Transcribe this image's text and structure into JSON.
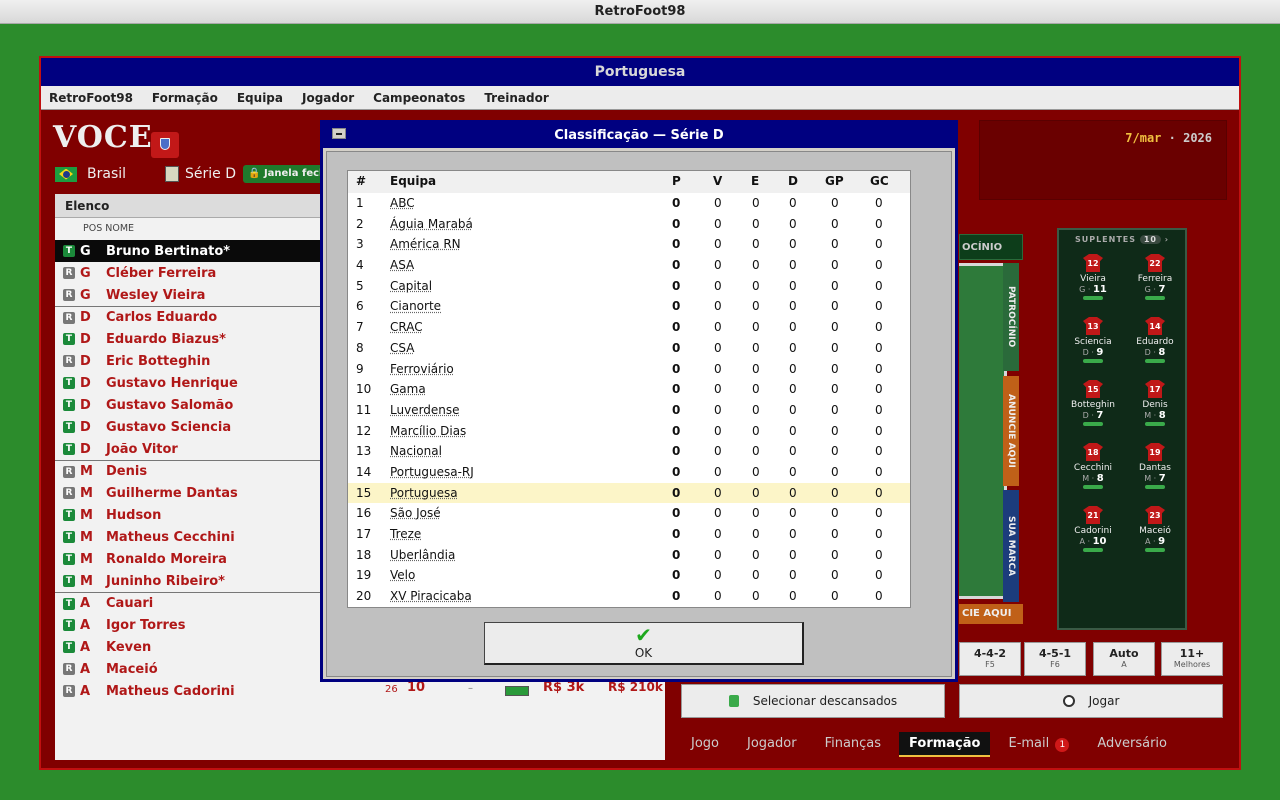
{
  "app_title": "RetroFoot98",
  "window_title": "Portuguesa",
  "menu": [
    "RetroFoot98",
    "Formação",
    "Equipa",
    "Jogador",
    "Campeonatos",
    "Treinador"
  ],
  "header": {
    "coach": "VOCE",
    "country": "Brasil",
    "division": "Série D",
    "window_status": "Janela fechada",
    "date": "7/mar",
    "year": "2026"
  },
  "roster": {
    "title": "Elenco",
    "col_pos": "POS",
    "col_name": "NOME",
    "players": [
      {
        "badge": "T",
        "pos": "G",
        "name": "Bruno Bertinato*"
      },
      {
        "badge": "R",
        "pos": "G",
        "name": "Cléber Ferreira"
      },
      {
        "badge": "R",
        "pos": "G",
        "name": "Wesley Vieira"
      },
      {
        "badge": "R",
        "pos": "D",
        "name": "Carlos Eduardo"
      },
      {
        "badge": "T",
        "pos": "D",
        "name": "Eduardo Biazus*"
      },
      {
        "badge": "R",
        "pos": "D",
        "name": "Eric Botteghin"
      },
      {
        "badge": "T",
        "pos": "D",
        "name": "Gustavo Henrique"
      },
      {
        "badge": "T",
        "pos": "D",
        "name": "Gustavo Salomão"
      },
      {
        "badge": "T",
        "pos": "D",
        "name": "Gustavo Sciencia"
      },
      {
        "badge": "T",
        "pos": "D",
        "name": "João Vitor"
      },
      {
        "badge": "R",
        "pos": "M",
        "name": "Denis"
      },
      {
        "badge": "R",
        "pos": "M",
        "name": "Guilherme Dantas"
      },
      {
        "badge": "T",
        "pos": "M",
        "name": "Hudson"
      },
      {
        "badge": "T",
        "pos": "M",
        "name": "Matheus Cecchini"
      },
      {
        "badge": "T",
        "pos": "M",
        "name": "Ronaldo Moreira"
      },
      {
        "badge": "T",
        "pos": "M",
        "name": "Juninho Ribeiro*"
      },
      {
        "badge": "T",
        "pos": "A",
        "name": "Cauari"
      },
      {
        "badge": "T",
        "pos": "A",
        "name": "Igor Torres"
      },
      {
        "badge": "T",
        "pos": "A",
        "name": "Keven"
      },
      {
        "badge": "R",
        "pos": "A",
        "name": "Maceió"
      },
      {
        "badge": "R",
        "pos": "A",
        "name": "Matheus Cadorini"
      }
    ],
    "last_row_extra": {
      "age": "26",
      "rating": "10",
      "dash": "–",
      "wage": "R$ 3k",
      "value": "R$ 210k"
    }
  },
  "pitch": {
    "tab_partial": "OCÍNIO",
    "ads": [
      "PATROCÍNIO",
      "ANUNCIE AQUI",
      "SUA MARCA"
    ],
    "bottom_ad": "CIE AQUI"
  },
  "bench": {
    "title": "SUPLENTES",
    "count": "10",
    "players": [
      {
        "num": "12",
        "name": "Vieira",
        "pos": "G",
        "rating": "11"
      },
      {
        "num": "22",
        "name": "Ferreira",
        "pos": "G",
        "rating": "7"
      },
      {
        "num": "13",
        "name": "Sciencia",
        "pos": "D",
        "rating": "9"
      },
      {
        "num": "14",
        "name": "Eduardo",
        "pos": "D",
        "rating": "8"
      },
      {
        "num": "15",
        "name": "Botteghin",
        "pos": "D",
        "rating": "7"
      },
      {
        "num": "17",
        "name": "Denis",
        "pos": "M",
        "rating": "8"
      },
      {
        "num": "18",
        "name": "Cecchini",
        "pos": "M",
        "rating": "8"
      },
      {
        "num": "19",
        "name": "Dantas",
        "pos": "M",
        "rating": "7"
      },
      {
        "num": "21",
        "name": "Cadorini",
        "pos": "A",
        "rating": "10"
      },
      {
        "num": "23",
        "name": "Maceió",
        "pos": "A",
        "rating": "9"
      }
    ]
  },
  "formations": [
    {
      "label": "4-4-2",
      "key": "F5"
    },
    {
      "label": "4-5-1",
      "key": "F6"
    },
    {
      "label": "Auto",
      "key": "A"
    },
    {
      "label": "11+",
      "key": "Melhores"
    }
  ],
  "buttons": {
    "rested": "Selecionar descansados",
    "play": "Jogar"
  },
  "bottom_tabs": [
    "Jogo",
    "Jogador",
    "Finanças",
    "Formação",
    "E-mail",
    "Adversário"
  ],
  "email_count": "1",
  "dialog": {
    "title": "Classificação — Série D",
    "columns": [
      "#",
      "Equipa",
      "P",
      "V",
      "E",
      "D",
      "GP",
      "GC"
    ],
    "rows": [
      [
        "1",
        "ABC",
        "0",
        "0",
        "0",
        "0",
        "0",
        "0"
      ],
      [
        "2",
        "Águia Marabá",
        "0",
        "0",
        "0",
        "0",
        "0",
        "0"
      ],
      [
        "3",
        "América RN",
        "0",
        "0",
        "0",
        "0",
        "0",
        "0"
      ],
      [
        "4",
        "ASA",
        "0",
        "0",
        "0",
        "0",
        "0",
        "0"
      ],
      [
        "5",
        "Capital",
        "0",
        "0",
        "0",
        "0",
        "0",
        "0"
      ],
      [
        "6",
        "Cianorte",
        "0",
        "0",
        "0",
        "0",
        "0",
        "0"
      ],
      [
        "7",
        "CRAC",
        "0",
        "0",
        "0",
        "0",
        "0",
        "0"
      ],
      [
        "8",
        "CSA",
        "0",
        "0",
        "0",
        "0",
        "0",
        "0"
      ],
      [
        "9",
        "Ferroviário",
        "0",
        "0",
        "0",
        "0",
        "0",
        "0"
      ],
      [
        "10",
        "Gama",
        "0",
        "0",
        "0",
        "0",
        "0",
        "0"
      ],
      [
        "11",
        "Luverdense",
        "0",
        "0",
        "0",
        "0",
        "0",
        "0"
      ],
      [
        "12",
        "Marcílio Dias",
        "0",
        "0",
        "0",
        "0",
        "0",
        "0"
      ],
      [
        "13",
        "Nacional",
        "0",
        "0",
        "0",
        "0",
        "0",
        "0"
      ],
      [
        "14",
        "Portuguesa-RJ",
        "0",
        "0",
        "0",
        "0",
        "0",
        "0"
      ],
      [
        "15",
        "Portuguesa",
        "0",
        "0",
        "0",
        "0",
        "0",
        "0"
      ],
      [
        "16",
        "São José",
        "0",
        "0",
        "0",
        "0",
        "0",
        "0"
      ],
      [
        "17",
        "Treze",
        "0",
        "0",
        "0",
        "0",
        "0",
        "0"
      ],
      [
        "18",
        "Uberlândia",
        "0",
        "0",
        "0",
        "0",
        "0",
        "0"
      ],
      [
        "19",
        "Velo",
        "0",
        "0",
        "0",
        "0",
        "0",
        "0"
      ],
      [
        "20",
        "XV Piracicaba",
        "0",
        "0",
        "0",
        "0",
        "0",
        "0"
      ]
    ],
    "highlight_team": "Portuguesa",
    "ok_label": "OK"
  },
  "colors": {
    "desktop": "#2c8c2c",
    "window_bg": "#800000",
    "title_bar": "#000080",
    "accent_red": "#b01818",
    "highlight_row": "#fcf5c8"
  }
}
